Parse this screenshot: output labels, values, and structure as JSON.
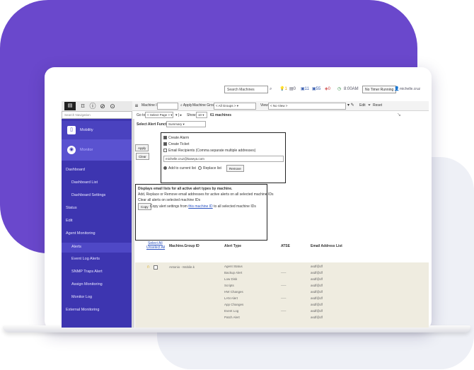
{
  "header": {
    "search_placeholder": "Search Machines",
    "counts": [
      "1",
      "0",
      "11",
      "55",
      "0"
    ],
    "time": "8:00AM",
    "user_button": "No Timer Running",
    "user_name": "michelle.cruz"
  },
  "toolbar": {
    "machine_id_label": "Machine ID:",
    "apply_label": "Apply",
    "machine_group_label": "Machine Group:",
    "machine_group_value": "< All Groups >",
    "view_label": "View:",
    "view_value": "< No View >",
    "edit_label": "Edit",
    "reset_label": "Reset"
  },
  "sidebar": {
    "search_placeholder": "Search Navigation",
    "items": [
      {
        "label": "Mobility",
        "icon": "mobility-icon"
      },
      {
        "label": "Monitor",
        "icon": "monitor-icon"
      },
      {
        "label": "Dashboard"
      },
      {
        "label": "Dashboard List"
      },
      {
        "label": "Dashboard Settings"
      },
      {
        "label": "Status"
      },
      {
        "label": "Edit"
      },
      {
        "label": "Agent Monitoring"
      },
      {
        "label": "Alerts"
      },
      {
        "label": "Event Log Alerts"
      },
      {
        "label": "SNMP Traps Alert"
      },
      {
        "label": "Assign Monitoring"
      },
      {
        "label": "Monitor Log"
      },
      {
        "label": "External Monitoring"
      }
    ]
  },
  "main": {
    "goto_label": "Go to:",
    "goto_value": "< Select Page >",
    "show_label": "Show",
    "show_value": "10",
    "machines_count": "61 machines",
    "select_alert_label": "Select Alert Function",
    "select_alert_value": "Summary",
    "apply_btn": "Apply",
    "clear_btn": "Clear",
    "opt_create_alarm": "Create Alarm",
    "opt_create_ticket": "Create Ticket",
    "opt_email": "Email Recipients (Comma separate multiple addresses)",
    "email_value": "michelle.cruz@kaseya.com",
    "add_to_current": "Add to current list",
    "replace_list": "Replace list",
    "remove_btn": "Remove",
    "info_line1": "Displays email lists for all active alert types by machine.",
    "info_line2": "Add, Replace or Remove email addresses for active alerts on all selected machine IDs",
    "info_line3": "Clear all alerts on selected machine IDs",
    "copy_btn": "Copy",
    "copy_text_pre": "Copy alert settings from",
    "copy_link": "this machine ID",
    "copy_text_post": "to all selected machine IDs",
    "grid": {
      "select_all": "Select All",
      "unselect_all": "Unselect All",
      "col_machine": "Machine.Group ID",
      "col_alert": "Alert Type",
      "col_atse": "ATSE",
      "col_email": "Email Address List",
      "machine_value": "Antonio - Mobile.k",
      "alert_types": [
        "Agent Status",
        "Backup Alert",
        "Low Disk",
        "Scripts",
        "HW Changes",
        "LAN Alert",
        "App Changes",
        "Event Log",
        "Patch Alert"
      ],
      "atse_values": [
        "-----",
        "-----",
        "-----",
        "-----"
      ],
      "email_values": [
        "asdf@df",
        "asdf@df",
        "asdf@df",
        "asdf@df",
        "asdf@df",
        "asdf@df",
        "asdf@df",
        "asdf@df",
        "asdf@df"
      ]
    }
  }
}
